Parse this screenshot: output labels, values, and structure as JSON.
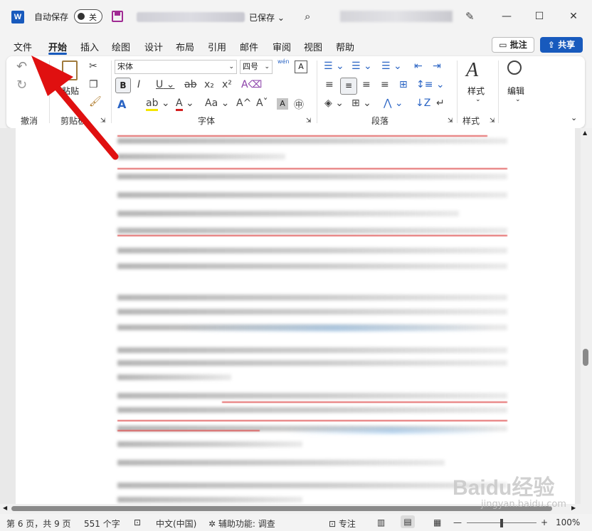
{
  "titlebar": {
    "app_icon": "W",
    "autosave_label": "自动保存",
    "autosave_state": "关",
    "saved_status": "已保存",
    "window_controls": [
      "—",
      "☐",
      "✕"
    ]
  },
  "tabs": [
    "文件",
    "开始",
    "插入",
    "绘图",
    "设计",
    "布局",
    "引用",
    "邮件",
    "审阅",
    "视图",
    "帮助"
  ],
  "actions": {
    "comment": "批注",
    "share": "共享"
  },
  "ribbon": {
    "groups": {
      "undo": "撤消",
      "clipboard": "剪贴板",
      "font": "字体",
      "paragraph": "段落",
      "styles": "样式"
    },
    "paste_label": "粘贴",
    "font_name": "宋体",
    "font_size": "四号",
    "phonetic_guide": "wén",
    "styles_button": "样式",
    "edit_button": "编辑",
    "format_buttons": {
      "bold": "B",
      "italic": "I",
      "underline": "U",
      "strike": "ab",
      "sub": "x₂",
      "sup": "x²",
      "grow": "A^",
      "shrink": "Aˇ",
      "case": "Aa"
    }
  },
  "statusbar": {
    "page": "第 6 页，共 9 页",
    "words": "551 个字",
    "language": "中文(中国)",
    "accessibility": "辅助功能: 调查",
    "focus": "专注",
    "zoom": "100%",
    "zoom_minus": "—",
    "zoom_plus": "+"
  },
  "watermark": {
    "text": "Baidu经验",
    "url": "jingyan.baidu.com"
  },
  "colors": {
    "accent": "#185abd",
    "arrow": "#e01010",
    "save_icon": "#a02b93"
  }
}
